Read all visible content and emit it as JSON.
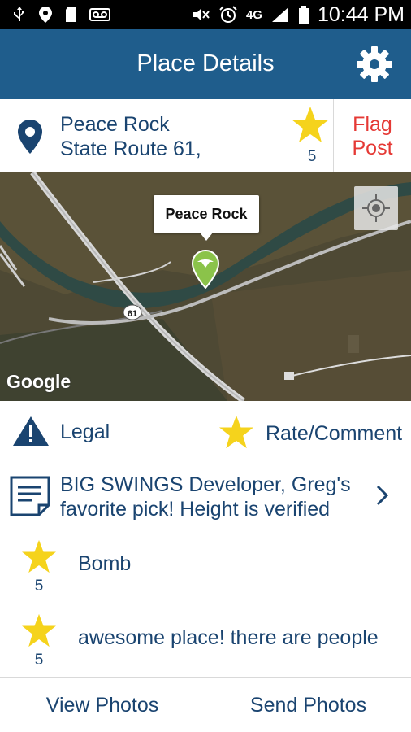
{
  "status_bar": {
    "network": "4G",
    "time": "10:44 PM"
  },
  "app_bar": {
    "title": "Place Details",
    "settings_icon": "gear-icon"
  },
  "place": {
    "name": "Peace Rock",
    "address": "State Route 61,",
    "rating": "5",
    "flag_label_1": "Flag",
    "flag_label_2": "Post"
  },
  "map": {
    "callout": "Peace Rock",
    "route_shield": "61",
    "attribution": "Google"
  },
  "actions": {
    "legal_label": "Legal",
    "rate_label": "Rate/Comment"
  },
  "note": {
    "line1": "BIG SWINGS Developer, Greg's",
    "line2": "favorite pick! Height is verified"
  },
  "comments": [
    {
      "rating": "5",
      "text": "Bomb"
    },
    {
      "rating": "5",
      "text": "awesome place! there are people"
    }
  ],
  "bottom": {
    "view_photos": "View Photos",
    "send_photos": "Send Photos"
  },
  "colors": {
    "app_bar": "#1f5d8c",
    "text_primary": "#1a4470",
    "star": "#f5d31c",
    "flag": "#e53935",
    "marker": "#8bc34a"
  }
}
